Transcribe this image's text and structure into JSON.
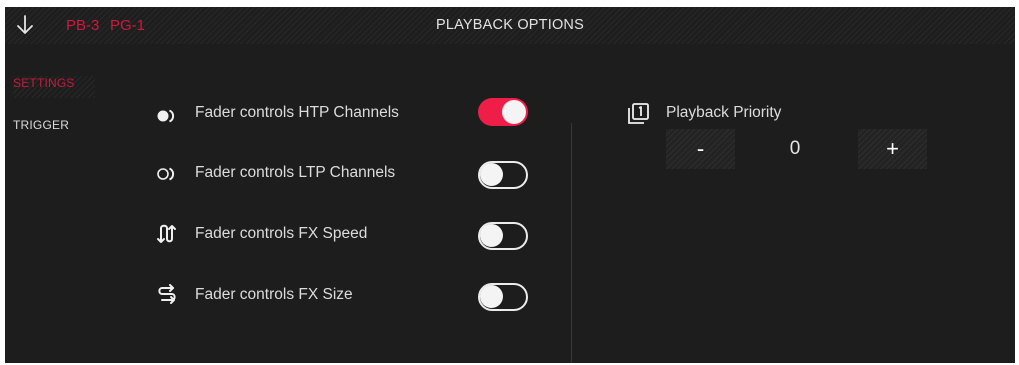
{
  "header": {
    "tags": [
      "PB-3",
      "PG-1"
    ],
    "title": "PLAYBACK OPTIONS",
    "back_icon": "arrow-down-icon"
  },
  "sidebar": {
    "items": [
      {
        "label": "SETTINGS",
        "active": true
      },
      {
        "label": "TRIGGER",
        "active": false
      }
    ]
  },
  "settings": [
    {
      "label": "Fader controls HTP Channels",
      "icon": "htp-channels-icon",
      "enabled": true
    },
    {
      "label": "Fader controls LTP Channels",
      "icon": "ltp-channels-icon",
      "enabled": false
    },
    {
      "label": "Fader controls FX Speed",
      "icon": "fx-speed-icon",
      "enabled": false
    },
    {
      "label": "Fader controls FX Size",
      "icon": "fx-size-icon",
      "enabled": false
    }
  ],
  "priority": {
    "label": "Playback Priority",
    "icon": "priority-icon",
    "value": "0",
    "decrement_label": "-",
    "increment_label": "+"
  },
  "colors": {
    "accent": "#ee1e48",
    "tag": "#d2173a",
    "background": "#1d1d1d",
    "text": "#dcdcdc"
  }
}
